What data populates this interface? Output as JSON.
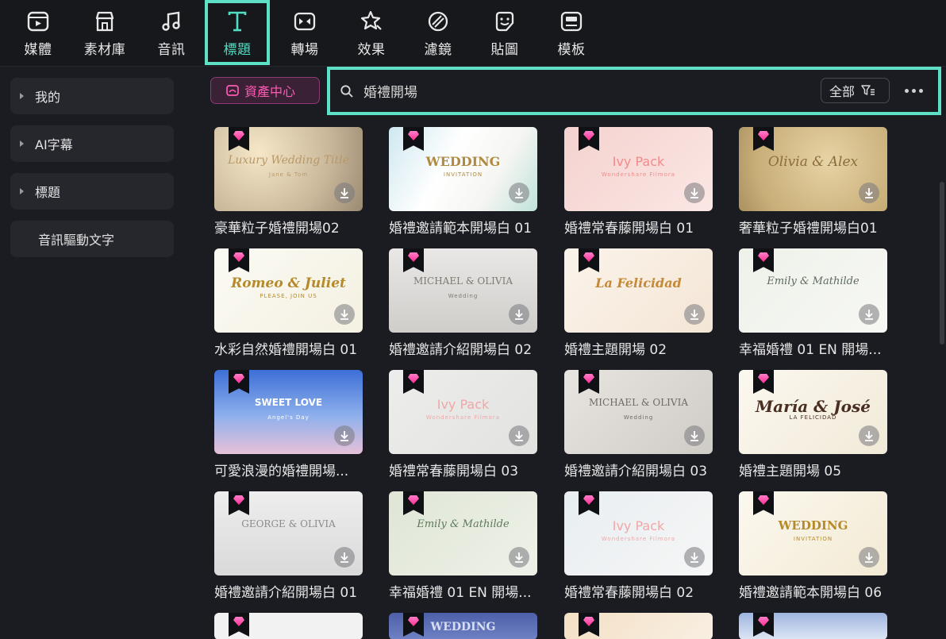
{
  "tabs": [
    {
      "label": "媒體",
      "icon": "media-icon"
    },
    {
      "label": "素材庫",
      "icon": "store-icon"
    },
    {
      "label": "音訊",
      "icon": "music-note-icon"
    },
    {
      "label": "標題",
      "icon": "title-t-icon",
      "active": true
    },
    {
      "label": "轉場",
      "icon": "transition-icon"
    },
    {
      "label": "效果",
      "icon": "effects-star-icon"
    },
    {
      "label": "濾鏡",
      "icon": "filter-icon"
    },
    {
      "label": "貼圖",
      "icon": "sticker-icon"
    },
    {
      "label": "模板",
      "icon": "template-icon"
    }
  ],
  "sidebar": {
    "items": [
      {
        "label": "我的",
        "expandable": true
      },
      {
        "label": "AI字幕",
        "expandable": true
      },
      {
        "label": "標題",
        "expandable": true
      },
      {
        "label": "音訊驅動文字",
        "expandable": false
      }
    ]
  },
  "toolbar": {
    "asset_center_label": "資產中心",
    "search_value": "婚禮開場",
    "filter_label": "全部"
  },
  "colors": {
    "accent": "#5ee0c7",
    "asset_pink": "#ff5ab4",
    "premium_gem": "#ff2c95"
  },
  "grid": {
    "items": [
      {
        "caption": "豪華粒子婚禮開場02",
        "thumb_text": "Luxury Wedding Title",
        "thumb_sub": "Jane & Tom"
      },
      {
        "caption": "婚禮邀請範本開場白 01",
        "thumb_text": "WEDDING",
        "thumb_sub": "INVITATION"
      },
      {
        "caption": "婚禮常春藤開場白 01",
        "thumb_text": "Ivy Pack",
        "thumb_sub": "Wondershare Filmora"
      },
      {
        "caption": "奢華粒子婚禮開場白01",
        "thumb_text": "Olivia & Alex",
        "thumb_sub": ""
      },
      {
        "caption": "水彩自然婚禮開場白 01",
        "thumb_text": "Romeo & Juliet",
        "thumb_sub": "PLEASE, JOIN US"
      },
      {
        "caption": "婚禮邀請介紹開場白 02",
        "thumb_text": "MICHAEL & OLIVIA",
        "thumb_sub": "Wedding"
      },
      {
        "caption": "婚禮主題開場 02",
        "thumb_text": "La Felicidad",
        "thumb_sub": ""
      },
      {
        "caption": "幸福婚禮 01 EN 開場...",
        "thumb_text": "Emily & Mathilde",
        "thumb_sub": ""
      },
      {
        "caption": "可愛浪漫的婚禮開場...",
        "thumb_text": "SWEET LOVE",
        "thumb_sub": "Angel's Day"
      },
      {
        "caption": "婚禮常春藤開場白 03",
        "thumb_text": "Ivy Pack",
        "thumb_sub": "Wondershare Filmora"
      },
      {
        "caption": "婚禮邀請介紹開場白 03",
        "thumb_text": "MICHAEL & OLIVIA",
        "thumb_sub": "Wedding"
      },
      {
        "caption": "婚禮主題開場 05",
        "thumb_text": "María & José",
        "thumb_sub": "LA FELICIDAD"
      },
      {
        "caption": "婚禮邀請介紹開場白 01",
        "thumb_text": "GEORGE & OLIVIA",
        "thumb_sub": ""
      },
      {
        "caption": "幸福婚禮 01 EN 開場...",
        "thumb_text": "Emily & Mathilde",
        "thumb_sub": ""
      },
      {
        "caption": "婚禮常春藤開場白 02",
        "thumb_text": "Ivy Pack",
        "thumb_sub": "Wondershare Filmora"
      },
      {
        "caption": "婚禮邀請範本開場白 06",
        "thumb_text": "WEDDING",
        "thumb_sub": "INVITATION"
      }
    ],
    "partial_row_text": [
      "",
      "WEDDING",
      "",
      ""
    ]
  }
}
